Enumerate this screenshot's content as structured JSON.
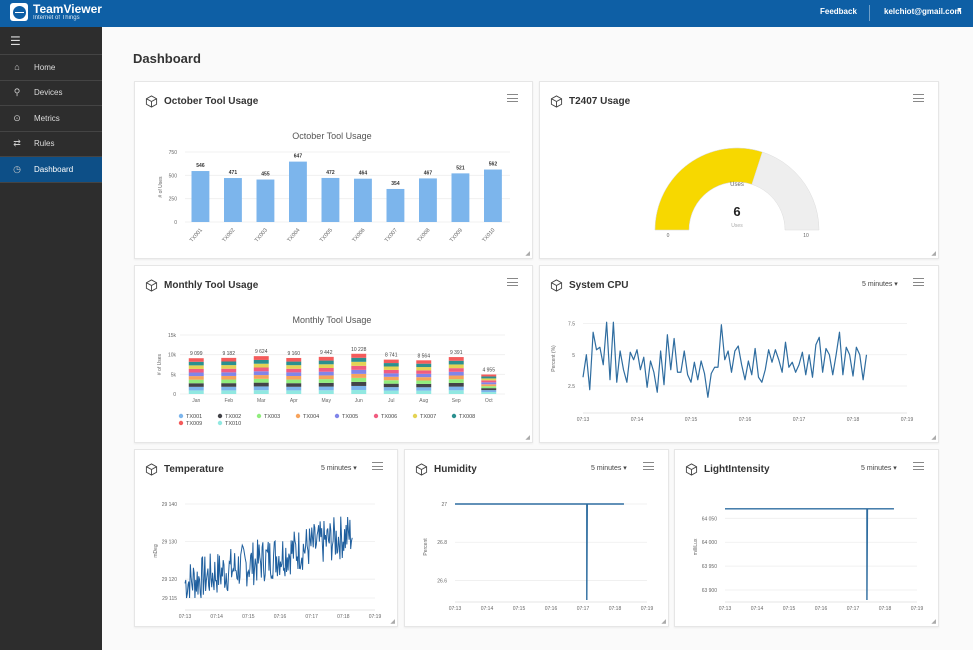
{
  "topbar": {
    "brand": "TeamViewer",
    "brand_sub": "Internet of Things",
    "feedback": "Feedback",
    "user": "kelchiot@gmail.com"
  },
  "sidebar": {
    "items": [
      {
        "label": "Home",
        "icon": "home-icon"
      },
      {
        "label": "Devices",
        "icon": "devices-icon"
      },
      {
        "label": "Metrics",
        "icon": "metrics-icon"
      },
      {
        "label": "Rules",
        "icon": "rules-icon"
      },
      {
        "label": "Dashboard",
        "icon": "dashboard-icon",
        "active": true
      }
    ]
  },
  "page_title": "Dashboard",
  "cards": {
    "october": {
      "title": "October Tool Usage"
    },
    "t2407": {
      "title": "T2407 Usage"
    },
    "monthly": {
      "title": "Monthly Tool Usage"
    },
    "cpu": {
      "title": "System CPU",
      "range": "5 minutes"
    },
    "temperature": {
      "title": "Temperature",
      "range": "5 minutes"
    },
    "humidity": {
      "title": "Humidity",
      "range": "5 minutes"
    },
    "light": {
      "title": "LightIntensity",
      "range": "5 minutes"
    }
  },
  "chart_data": [
    {
      "id": "october",
      "type": "bar",
      "title": "October Tool Usage",
      "xlabel": "",
      "ylabel": "# of Uses",
      "categories": [
        "TX001",
        "TX002",
        "TX003",
        "TX004",
        "TX005",
        "TX006",
        "TX007",
        "TX008",
        "TX009",
        "TX010"
      ],
      "values": [
        546,
        471,
        455,
        647,
        472,
        464,
        354,
        467,
        521,
        562
      ],
      "yticks": [
        0,
        250,
        500,
        750
      ],
      "ylim": [
        0,
        750
      ],
      "color": "#7cb5ec"
    },
    {
      "id": "gauge",
      "type": "gauge",
      "title": "Uses",
      "value": 6,
      "min": 0,
      "max": 10,
      "unit": "Uses",
      "fill_color": "#f7d800",
      "track_color": "#eeeeee"
    },
    {
      "id": "monthly",
      "type": "bar",
      "stacked": true,
      "title": "Monthly Tool Usage",
      "ylabel": "# of Uses",
      "categories": [
        "Jan",
        "Feb",
        "Mar",
        "Apr",
        "May",
        "Jun",
        "Jul",
        "Aug",
        "Sep",
        "Oct"
      ],
      "totals": [
        9099,
        9182,
        9624,
        9160,
        9442,
        10228,
        8741,
        8564,
        9391,
        4955
      ],
      "total_labels": [
        "9 099",
        "9 182",
        "9 624",
        "9 160",
        "9 442",
        "10 228",
        "8 741",
        "8 564",
        "9 391",
        "4 955"
      ],
      "yticks": [
        "0",
        "5k",
        "10k",
        "15k"
      ],
      "ylim": [
        0,
        15000
      ],
      "series": [
        {
          "name": "TX001",
          "color": "#7cb5ec"
        },
        {
          "name": "TX002",
          "color": "#434348"
        },
        {
          "name": "TX003",
          "color": "#90ed7d"
        },
        {
          "name": "TX004",
          "color": "#f7a35c"
        },
        {
          "name": "TX005",
          "color": "#8085e9"
        },
        {
          "name": "TX006",
          "color": "#f15c80"
        },
        {
          "name": "TX007",
          "color": "#e4d354"
        },
        {
          "name": "TX008",
          "color": "#2b908f"
        },
        {
          "name": "TX009",
          "color": "#f45b5b"
        },
        {
          "name": "TX010",
          "color": "#91e8e1"
        }
      ],
      "legend": "bottom"
    },
    {
      "id": "cpu",
      "type": "line",
      "ylabel": "Percent (%)",
      "yticks": [
        "2.5",
        "5",
        "7.5"
      ],
      "ylim": [
        1.3,
        8.1
      ],
      "xticks": [
        "07:13",
        "07:14",
        "07:15",
        "07:16",
        "07:17",
        "07:18",
        "07:19"
      ],
      "values": [
        3.2,
        5.0,
        2.2,
        6.8,
        5.4,
        5.6,
        4.2,
        7.6,
        3.0,
        7.6,
        2.8,
        5.3,
        3.8,
        2.8,
        5.2,
        4.6,
        5.4,
        3.8,
        4.8,
        2.4,
        4.5,
        3.6,
        2.0,
        5.3,
        2.6,
        6.6,
        3.8,
        6.3,
        3.6,
        3.6,
        5.3,
        3.4,
        2.8,
        4.4,
        3.0,
        4.5,
        3.5,
        1.6,
        3.5,
        4.0,
        4.0,
        7.4,
        4.6,
        5.3,
        3.6,
        5.3,
        5.7,
        4.2,
        3.0,
        4.5,
        3.4,
        5.5,
        3.2,
        2.8,
        3.8,
        5.4,
        4.4,
        5.4,
        4.6,
        3.6,
        6.0,
        4.0,
        4.4,
        3.6,
        4.2,
        5.2,
        3.4,
        5.0,
        3.2,
        5.8,
        6.4,
        3.6,
        5.5,
        5.0,
        3.4,
        5.0,
        6.8,
        3.4,
        5.6,
        5.0,
        3.3,
        5.6,
        5.0,
        3.0,
        5.0
      ],
      "color": "#2f6da0"
    },
    {
      "id": "temperature",
      "type": "line",
      "ylabel": "mDeg",
      "yticks": [
        "29 115",
        "29 120",
        "29 130",
        "29 140"
      ],
      "ylim": [
        29115,
        29140
      ],
      "ytick_values": [
        29115,
        29120,
        29130,
        29140
      ],
      "xticks": [
        "07:13",
        "07:14",
        "07:15",
        "07:16",
        "07:17",
        "07:18",
        "07:19"
      ],
      "color": "#1f5f9e"
    },
    {
      "id": "humidity",
      "type": "line",
      "ylabel": "Percent",
      "yticks": [
        "26.6",
        "26.8",
        "27"
      ],
      "ylim": [
        26.55,
        27.0
      ],
      "xticks": [
        "07:13",
        "07:14",
        "07:15",
        "07:16",
        "07:17",
        "07:18",
        "07:19"
      ],
      "baseline": 27,
      "dip_value": 26.5,
      "dip_at": 0.78,
      "color": "#2f6da0"
    },
    {
      "id": "light",
      "type": "line",
      "ylabel": "milliLux",
      "yticks": [
        "63 900",
        "63 950",
        "64 000",
        "64 050"
      ],
      "ylim": [
        63900,
        64080
      ],
      "xticks": [
        "07:13",
        "07:14",
        "07:15",
        "07:16",
        "07:17",
        "07:18",
        "07:19"
      ],
      "baseline": 64070,
      "dip_value": 63900,
      "dip_at": 0.84,
      "color": "#2f6da0"
    }
  ]
}
